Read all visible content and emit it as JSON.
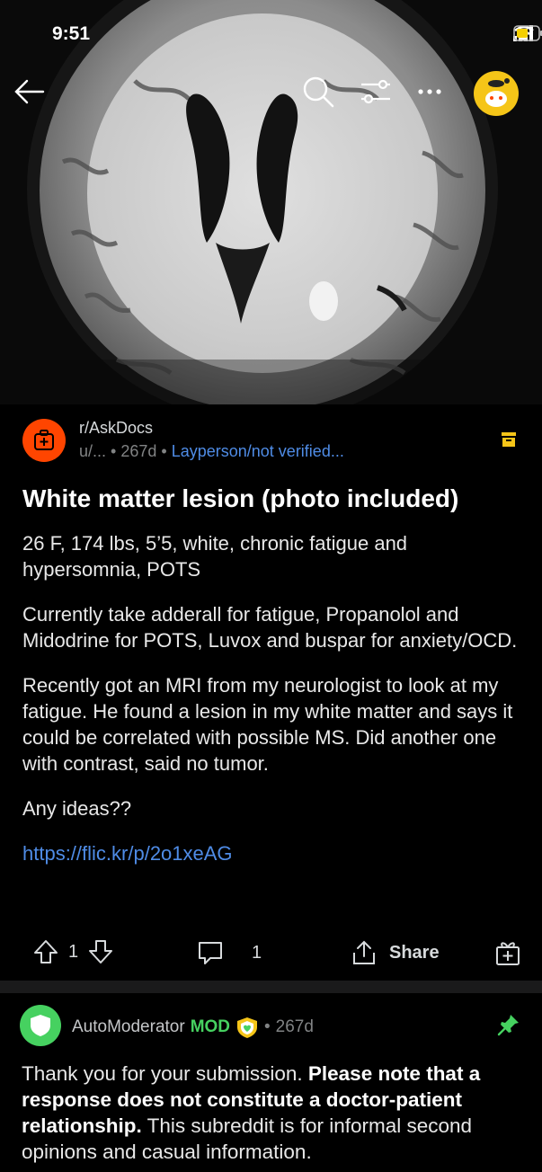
{
  "status_bar": {
    "time": "9:51"
  },
  "post": {
    "subreddit": "r/AskDocs",
    "author": "u/...",
    "age": "267d",
    "flair": "Layperson/not verified...",
    "title": "White matter lesion (photo included)",
    "paragraphs": [
      "26 F, 174 lbs, 5’5, white, chronic fatigue and hypersomnia, POTS",
      "Currently take adderall for fatigue, Propanolol and Midodrine for POTS, Luvox and buspar for anxiety/OCD.",
      "Recently got an MRI from my neurologist to look at my fatigue. He found a lesion in my white matter and says it could be correlated with possible MS. Did another one with contrast, said no tumor.",
      "Any ideas??"
    ],
    "link": "https://flic.kr/p/2o1xeAG",
    "actions": {
      "votes": "1",
      "comments": "1",
      "share_label": "Share"
    }
  },
  "comment": {
    "author": "AutoModerator",
    "mod_label": "MOD",
    "age": "267d",
    "text_1": "Thank you for your submission. ",
    "text_bold_1": "Please note that a response does not constitute a doctor-patient relationship.",
    "text_2": " This subreddit is for informal second opinions and casual information."
  },
  "colors": {
    "accent": "#ff4500",
    "link": "#4f8ce6",
    "mod": "#46d160",
    "save": "#f5c518"
  },
  "icons": [
    "back-icon",
    "search-icon",
    "filter-icon",
    "more-icon",
    "user-avatar",
    "save-icon",
    "upvote-icon",
    "downvote-icon",
    "comment-icon",
    "share-icon",
    "award-icon",
    "pin-icon"
  ]
}
